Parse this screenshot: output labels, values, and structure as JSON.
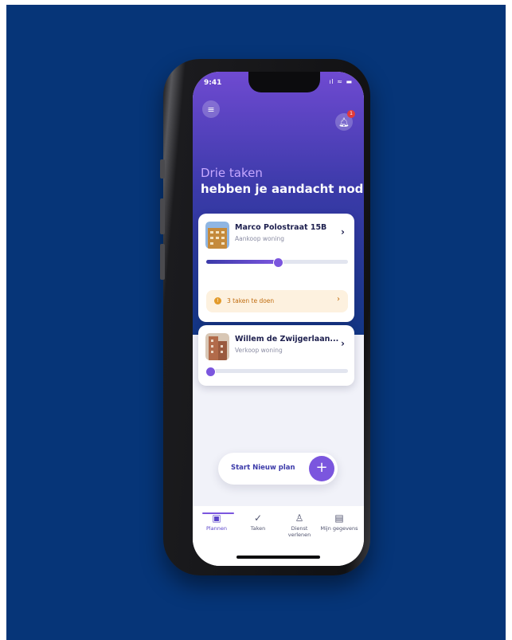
{
  "status_bar": {
    "time": "9:41",
    "icons": "ıl ≈ ▬"
  },
  "header": {
    "menu_icon": "menu-icon",
    "bell_icon": "bell-icon",
    "notification_count": "1",
    "headline_line1": "Drie taken",
    "headline_line2": "hebben je aandacht nodig"
  },
  "plans": [
    {
      "title": "Marco Polostraat 15B",
      "subtitle": "Aankoop woning",
      "progress": 0.5,
      "tasks_label": "3 taken te doen"
    },
    {
      "title": "Willem de Zwijgerlaan...",
      "subtitle": "Verkoop woning",
      "progress": 0.02
    }
  ],
  "cta": {
    "label": "Start Nieuw plan",
    "icon": "+"
  },
  "tabs": [
    {
      "label": "Plannen",
      "icon": "▣",
      "active": true
    },
    {
      "label": "Taken",
      "icon": "✓",
      "active": false
    },
    {
      "label": "Dienst verlenen",
      "icon": "♙",
      "active": false
    },
    {
      "label": "Mijn gegevens",
      "icon": "▤",
      "active": false
    }
  ],
  "colors": {
    "background": "#063578",
    "accent": "#7b56de",
    "header_top": "#6f4ad1",
    "task_badge": "#e39b2b"
  }
}
